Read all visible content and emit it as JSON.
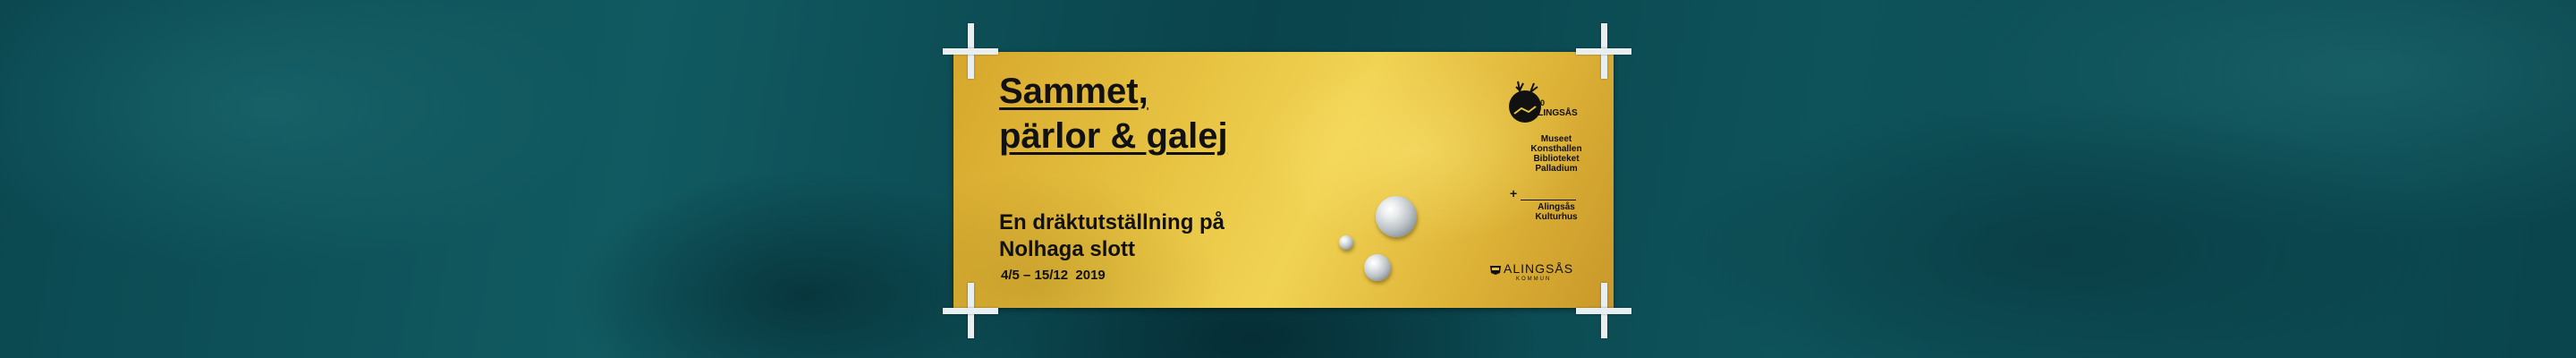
{
  "banner": {
    "title_line1": "Sammet,",
    "title_line2": "pärlor & galej",
    "subtitle_line1": "En dräktutställning på",
    "subtitle_line2": "Nolhaga slott",
    "dates": "4/5 – 15/12  2019"
  },
  "logos": {
    "anniversary_number": "700",
    "anniversary_name": "ALINGSÅS",
    "institutions": [
      "Museet",
      "Konsthallen",
      "Biblioteket"
    ],
    "plus": "+",
    "institution_extra": "Palladium",
    "culture_house": [
      "Alingsås",
      "Kulturhus"
    ],
    "municipality_name": "ALINGSÅS",
    "municipality_sub": "KOMMUN"
  },
  "colors": {
    "background": "#0c4a52",
    "card_gold": "#e8c443",
    "text": "#111111",
    "pin": "#e9eef0"
  }
}
